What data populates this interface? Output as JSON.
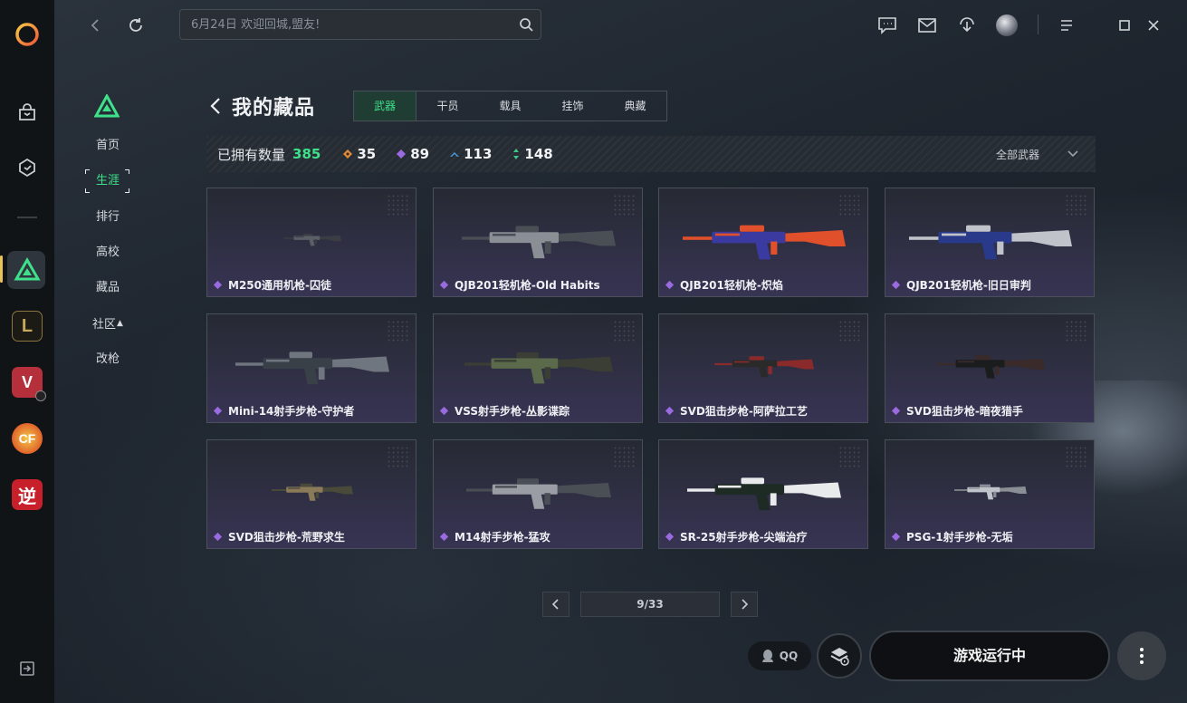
{
  "search": {
    "placeholder": "6月24日 欢迎回城,盟友!"
  },
  "subnav": {
    "items": [
      {
        "label": "首页",
        "active": false
      },
      {
        "label": "生涯",
        "active": true
      },
      {
        "label": "排行",
        "active": false
      },
      {
        "label": "高校",
        "active": false
      },
      {
        "label": "藏品",
        "active": false
      },
      {
        "label": "社区",
        "active": false
      },
      {
        "label": "改枪",
        "active": false
      }
    ]
  },
  "page": {
    "title": "我的藏品"
  },
  "tabs": [
    "武器",
    "干员",
    "载具",
    "挂饰",
    "典藏"
  ],
  "stats": {
    "owned_label": "已拥有数量",
    "owned_total": "385",
    "counts": [
      {
        "icon": "orange-gem-icon",
        "color": "#e08a3a",
        "value": "35"
      },
      {
        "icon": "purple-gem-icon",
        "color": "#9a6ae0",
        "value": "89"
      },
      {
        "icon": "blue-chevron-icon",
        "color": "#4a9ae0",
        "value": "113"
      },
      {
        "icon": "green-arrows-icon",
        "color": "#3ec68a",
        "value": "148"
      }
    ],
    "filter_label": "全部武器"
  },
  "items": [
    {
      "name": "M250通用机枪-囚徒"
    },
    {
      "name": "QJB201轻机枪-Old Habits"
    },
    {
      "name": "QJB201轻机枪-炽焰"
    },
    {
      "name": "QJB201轻机枪-旧日审判"
    },
    {
      "name": "Mini-14射手步枪-守护者"
    },
    {
      "name": "VSS射手步枪-丛影谍踪"
    },
    {
      "name": "SVD狙击步枪-阿萨拉工艺"
    },
    {
      "name": "SVD狙击步枪-暗夜猎手"
    },
    {
      "name": "SVD狙击步枪-荒野求生"
    },
    {
      "name": "M14射手步枪-猛攻"
    },
    {
      "name": "SR-25射手步枪-尖端治疗"
    },
    {
      "name": "PSG-1射手步枪-无垢"
    }
  ],
  "pagination": {
    "label": "9/33"
  },
  "bottom": {
    "qq_label": "QQ",
    "run_label": "游戏运行中"
  },
  "colors": {
    "accent_green": "#3ee08a",
    "rarity_purple": "#9a6ae0"
  }
}
